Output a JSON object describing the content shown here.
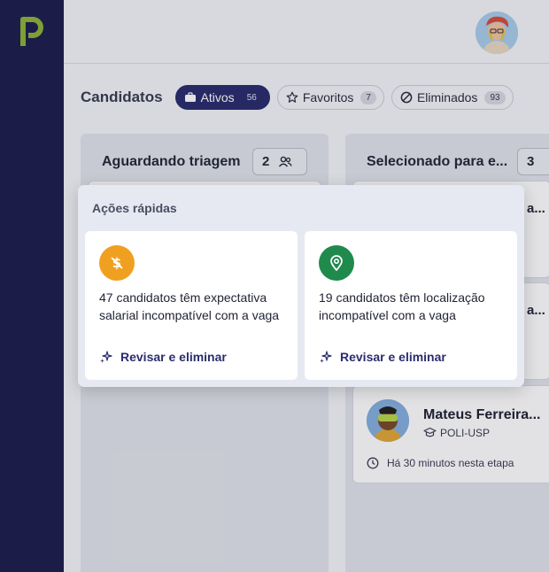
{
  "header": {
    "title": "Candidatos"
  },
  "tabs": [
    {
      "label": "Ativos",
      "count": "56",
      "icon": "briefcase-icon",
      "active": true
    },
    {
      "label": "Favoritos",
      "count": "7",
      "icon": "star-icon",
      "active": false
    },
    {
      "label": "Eliminados",
      "count": "93",
      "icon": "block-icon",
      "active": false
    }
  ],
  "columns": [
    {
      "title": "Aguardando triagem",
      "count": "2"
    },
    {
      "title": "Selecionado para e...",
      "count": "3"
    }
  ],
  "stubs": {
    "s1": "a...",
    "s2": "a..."
  },
  "candidate": {
    "name": "Mateus Ferreira...",
    "school": "POLI-USP",
    "time": "Há 30 minutos nesta etapa"
  },
  "quick_actions": {
    "title": "Ações rápidas",
    "items": [
      {
        "text": "47 candidatos têm expectativa salarial incompatível com a vaga",
        "link": "Revisar e eliminar",
        "icon": "no-money-icon",
        "color": "#f0a020"
      },
      {
        "text": "19 candidatos têm localização incompatível com a vaga",
        "link": "Revisar e eliminar",
        "icon": "location-pin-icon",
        "color": "#1f8a4c"
      }
    ]
  },
  "colors": {
    "sidebar": "#1d1f4e",
    "accent": "#2b2d6e",
    "logo": "#8fb33a"
  }
}
